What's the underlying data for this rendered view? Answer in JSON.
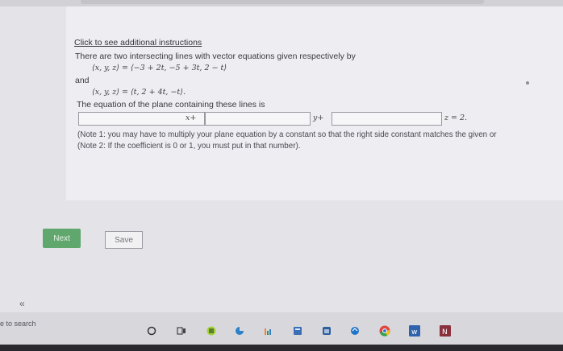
{
  "question": {
    "instructions_link": "Click to see additional instructions",
    "intro": "There are two intersecting lines with vector equations given respectively by",
    "eq1": "⟨x, y, z⟩ = ⟨−3 + 2t, −5 + 3t, 2 − t⟩",
    "and_text": "and",
    "eq2": "⟨x, y, z⟩ = ⟨t, 2 + 4t, −t⟩.",
    "plane_prompt": "The equation of the plane containing these lines is",
    "x_label": "x+",
    "y_label": "y+",
    "z_label": "z = 2.",
    "note1": "(Note 1: you may have to multiply your plane equation by a constant so that the right side constant matches the given or",
    "note2": "(Note 2: If the coefficient is 0 or 1, you must put in that number).",
    "input_x_value": "",
    "input_y_value": "",
    "input_z_value": ""
  },
  "buttons": {
    "next": "Next",
    "save": "Save"
  },
  "sidebar": {
    "collapse": "«"
  },
  "taskbar": {
    "search_text": "e to search",
    "icons": [
      "search-circle-icon",
      "task-view-icon",
      "media-player-icon",
      "edge-icon",
      "chart-app-icon",
      "calculator-icon",
      "store-icon",
      "browser-icon",
      "chrome-icon",
      "word-icon",
      "onenote-icon"
    ]
  },
  "colors": {
    "next_button": "#5fa76d",
    "page_background": "#e4e3e8",
    "card_background": "#eeedf1"
  }
}
